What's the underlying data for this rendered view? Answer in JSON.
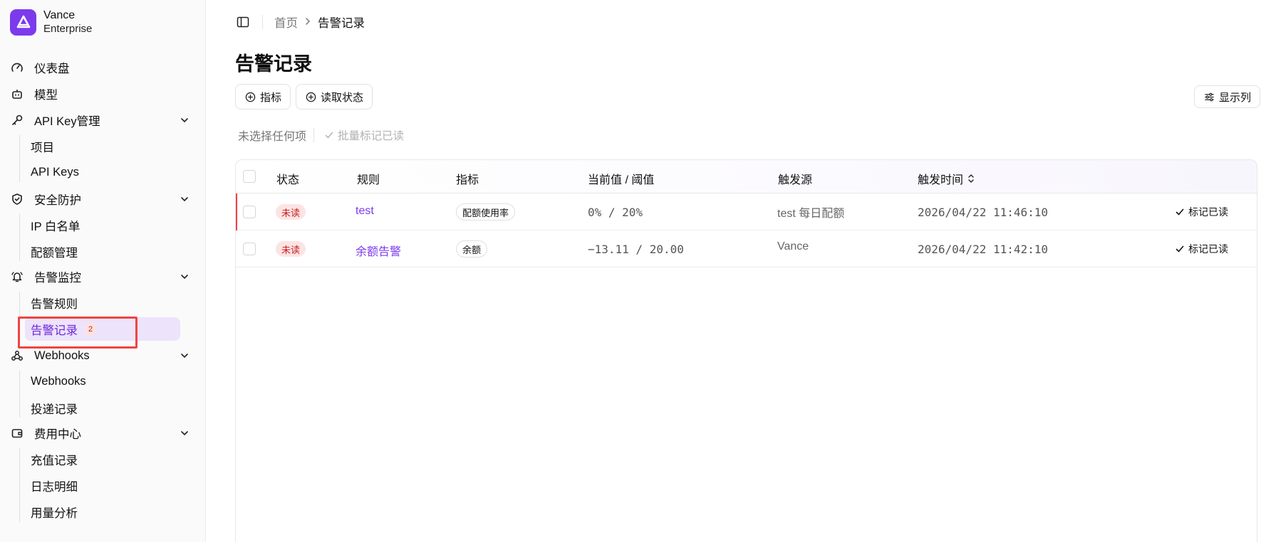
{
  "brand": {
    "name": "Vance",
    "sub": "Enterprise"
  },
  "sidebar": {
    "dashboard": "仪表盘",
    "models": "模型",
    "apikey_group": "API Key管理",
    "apikey_items": [
      "项目",
      "API Keys"
    ],
    "security_group": "安全防护",
    "security_items": [
      "IP 白名单",
      "配额管理"
    ],
    "alert_group": "告警监控",
    "alert_items": [
      "告警规则",
      "告警记录"
    ],
    "alert_records_count": "2",
    "webhooks_group": "Webhooks",
    "webhooks_items": [
      "Webhooks",
      "投递记录"
    ],
    "billing_group": "费用中心",
    "billing_items": [
      "充值记录",
      "日志明细",
      "用量分析"
    ]
  },
  "breadcrumb": {
    "home": "首页",
    "current": "告警记录"
  },
  "page": {
    "title": "告警记录"
  },
  "toolbar": {
    "filter_metric": "指标",
    "filter_read": "读取状态",
    "columns": "显示列"
  },
  "selection": {
    "none": "未选择任何项",
    "bulk_mark": "批量标记已读"
  },
  "table": {
    "headers": {
      "status": "状态",
      "rule": "规则",
      "metric": "指标",
      "value": "当前值 / 阈值",
      "source": "触发源",
      "time": "触发时间"
    },
    "rows": [
      {
        "status": "未读",
        "rule": "test",
        "metric": "配额使用率",
        "value": "0% / 20%",
        "source": "test 每日配额",
        "time": "2026/04/22 11:46:10",
        "action": "标记已读"
      },
      {
        "status": "未读",
        "rule": "余额告警",
        "metric": "余额",
        "value": "−13.11 / 20.00",
        "source": "Vance",
        "time": "2026/04/22 11:42:10",
        "action": "标记已读"
      }
    ]
  },
  "colors": {
    "accent": "#7c3aed",
    "active_bg": "#ede3fb",
    "unread_badge_bg": "#fde4e4",
    "unread_badge_text": "#c81e1e",
    "highlight": "#ef4444"
  }
}
